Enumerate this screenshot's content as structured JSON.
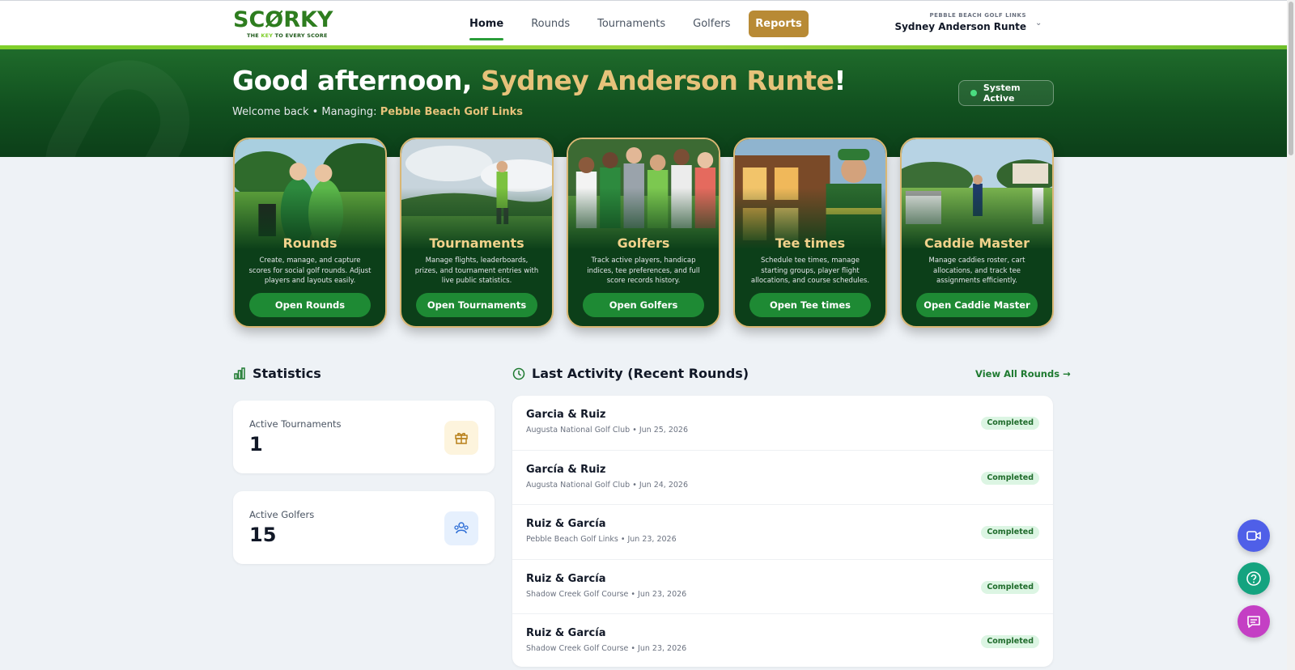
{
  "header": {
    "logo_left": "SC",
    "logo_o": "Ø",
    "logo_right": "RKY",
    "logo_tag_a": "THE ",
    "logo_tag_key": "KEY",
    "logo_tag_b": " TO EVERY SCORE",
    "nav": [
      {
        "label": "Home",
        "active": true
      },
      {
        "label": "Rounds"
      },
      {
        "label": "Tournaments"
      },
      {
        "label": "Golfers"
      }
    ],
    "reports_label": "Reports",
    "user_club": "PEBBLE BEACH GOLF LINKS",
    "user_name": "Sydney Anderson Runte",
    "caret": "⌄"
  },
  "hero": {
    "greet_prefix": "Good afternoon, ",
    "greet_name": "Sydney Anderson Runte",
    "greet_suffix": "!",
    "welcome_prefix": "Welcome back • Managing: ",
    "welcome_club": "Pebble Beach Golf Links",
    "status": "System Active"
  },
  "cards": [
    {
      "title": "Rounds",
      "desc": "Create, manage, and capture scores for social golf rounds. Adjust players and layouts easily.",
      "button": "Open Rounds"
    },
    {
      "title": "Tournaments",
      "desc": "Manage flights, leaderboards, prizes, and tournament entries with live public statistics.",
      "button": "Open Tournaments"
    },
    {
      "title": "Golfers",
      "desc": "Track active players, handicap indices, tee preferences, and full score records history.",
      "button": "Open Golfers"
    },
    {
      "title": "Tee times",
      "desc": "Schedule tee times, manage starting groups, player flight allocations, and course schedules.",
      "button": "Open Tee times"
    },
    {
      "title": "Caddie Master",
      "desc": "Manage caddies roster, cart allocations, and track tee assignments efficiently.",
      "button": "Open Caddie Master"
    }
  ],
  "statistics": {
    "title": "Statistics",
    "items": [
      {
        "label": "Active Tournaments",
        "value": "1"
      },
      {
        "label": "Active Golfers",
        "value": "15"
      }
    ]
  },
  "activity": {
    "title": "Last Activity (Recent Rounds)",
    "view_all": "View All Rounds →",
    "rows": [
      {
        "name": "Garcia & Ruiz",
        "meta": "Augusta National Golf Club • Jun 25, 2026",
        "status": "Completed"
      },
      {
        "name": "García & Ruiz",
        "meta": "Augusta National Golf Club • Jun 24, 2026",
        "status": "Completed"
      },
      {
        "name": "Ruiz & García",
        "meta": "Pebble Beach Golf Links • Jun 23, 2026",
        "status": "Completed"
      },
      {
        "name": "Ruiz & García",
        "meta": "Shadow Creek Golf Course • Jun 23, 2026",
        "status": "Completed"
      },
      {
        "name": "Ruiz & García",
        "meta": "Shadow Creek Golf Course • Jun 23, 2026",
        "status": "Completed"
      }
    ]
  },
  "fabs": [
    {
      "icon": "video-icon",
      "color": "#4f5fe8"
    },
    {
      "icon": "help-icon",
      "color": "#14a37f"
    },
    {
      "icon": "chat-icon",
      "color": "#c43fc4"
    }
  ]
}
